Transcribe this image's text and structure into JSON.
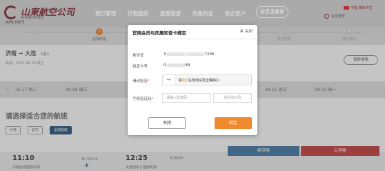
{
  "header": {
    "logo_cn": "山東航空公司",
    "logo_en1": "SHANDONG",
    "logo_en2": "AIRLINES",
    "nav": [
      "预订管理",
      "行程服务",
      "度假旅游",
      "凤凰知音",
      "政企客户"
    ],
    "hotline": "95369",
    "lang": "中国·简体中文",
    "links": "会员登录"
  },
  "steps": [
    "1",
    "2",
    "3",
    "4",
    "5",
    "6"
  ],
  "step_labels": [
    "",
    "选择航班",
    "",
    "",
    "支付信息",
    "预订成功"
  ],
  "route": {
    "title": "济南 ⇀ 大连",
    "pax": "1成人",
    "sub": "去程：2021-08-20 周五",
    "rebook": "重新搜索"
  },
  "dates": [
    "36-17 周二",
    "08-18 周三",
    "08-22 周日",
    "08-23 周一"
  ],
  "section": {
    "title": "请选择适合您的航班",
    "filters": [
      "价格",
      "航司",
      "全部航班"
    ]
  },
  "fare_tabs": [
    "经济舱",
    "公务舱"
  ],
  "flight": {
    "dep_time": "11:10",
    "dep_airport": "济南遥墙国际机场",
    "duration": "1h 15min",
    "arr_time": "12:25",
    "arr_airport": "大连周水子国际机场",
    "flight_no": "SC8603"
  },
  "modal": {
    "title": "官网会员与凤凰知音卡绑定",
    "close": "关闭",
    "id_label": "身份证",
    "id_prefix": "3",
    "id_suffix": "7236",
    "card_label": "知音卡号",
    "card_prefix": "0",
    "card_suffix": "83",
    "slider_label": "滑动验证",
    "slider_hint_pre": "请",
    "slider_hint_em": "拖动",
    "slider_hint_post": "左侧滑块至正确缺口",
    "code_label": "手机验证码",
    "code_placeholder": "请输入验证码",
    "get_code": "获取验证码",
    "btn_close": "关闭",
    "btn_bind": "绑定",
    "accent": "#ef8a2f"
  }
}
